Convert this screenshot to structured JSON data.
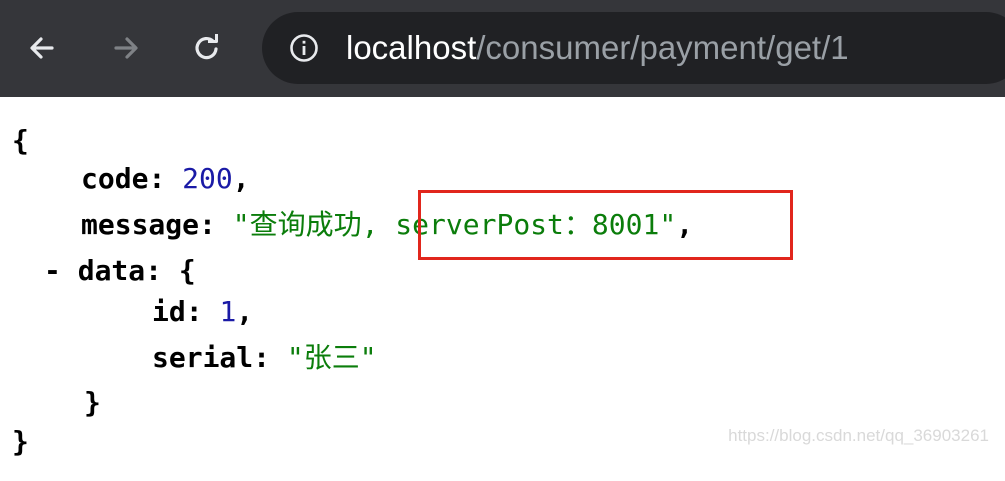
{
  "browser": {
    "back_icon": "arrow-left-icon",
    "forward_icon": "arrow-right-icon",
    "reload_icon": "reload-icon",
    "info_icon": "info-icon",
    "url_host": "localhost",
    "url_path": "/consumer/payment/get/1",
    "colors": {
      "toolbar": "#35363a",
      "omnibox": "#202124",
      "host_text": "#ffffff",
      "path_text": "#9aa0a6"
    }
  },
  "json_view": {
    "open_brace": "{",
    "code_key": "code",
    "code_value": "200",
    "message_key": "message",
    "message_value_part1": "\"查询成功,",
    "message_value_part2": " serverPost：8001\"",
    "data_toggle": "-",
    "data_key": "data",
    "data_open": "{",
    "id_key": "id",
    "id_value": "1",
    "serial_key": "serial",
    "serial_value": "\"张三\"",
    "data_close": "}",
    "close_brace": "}",
    "colors": {
      "number": "#1a1aa6",
      "string": "#0b7d0b",
      "highlight_border": "#e1261c"
    }
  },
  "watermark": "https://blog.csdn.net/qq_36903261"
}
